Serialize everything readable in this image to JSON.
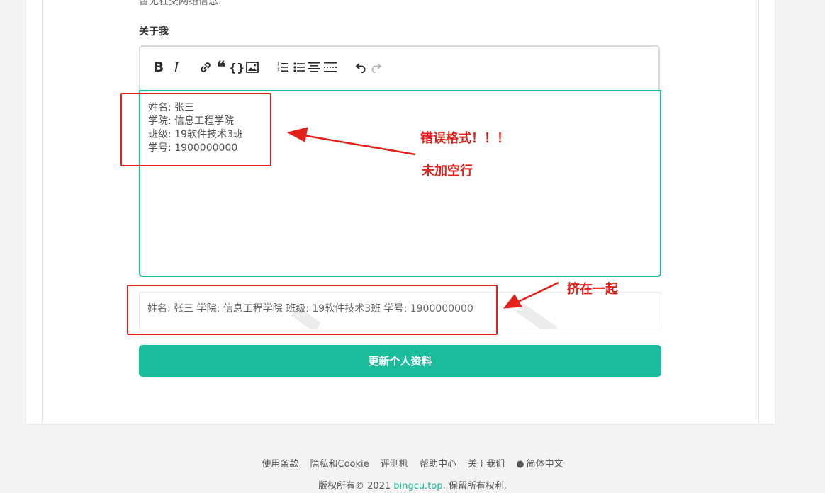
{
  "page": {
    "cut_text": "暂无社交网络信息.",
    "section_label": "关于我"
  },
  "toolbar": {
    "buttons": [
      {
        "name": "bold-icon",
        "glyph": "B"
      },
      {
        "name": "italic-icon",
        "glyph": "I"
      },
      {
        "name": "link-icon"
      },
      {
        "name": "quote-icon",
        "glyph": "66"
      },
      {
        "name": "code-icon",
        "glyph": "{}"
      },
      {
        "name": "image-icon"
      },
      {
        "name": "ordered-list-icon"
      },
      {
        "name": "unordered-list-icon"
      },
      {
        "name": "horizontal-rule-icon"
      },
      {
        "name": "page-break-icon"
      },
      {
        "name": "undo-icon"
      },
      {
        "name": "redo-icon"
      }
    ]
  },
  "editor": {
    "lines": [
      "姓名: 张三",
      "学院: 信息工程学院",
      "班级: 19软件技术3班",
      "学号: 1900000000"
    ]
  },
  "preview": {
    "text": "姓名: 张三 学院: 信息工程学院 班级: 19软件技术3班 学号: 1900000000"
  },
  "submit": {
    "label": "更新个人资料"
  },
  "annotations": {
    "wrong_format": "错误格式！！！",
    "no_blank_line": "未加空行",
    "squeezed": "挤在一起",
    "color": "#e3201b"
  },
  "footer": {
    "links": [
      "使用条款",
      "隐私和Cookie",
      "评测机",
      "帮助中心",
      "关于我们"
    ],
    "language": "简体中文",
    "copyright_prefix": "版权所有© 2021 ",
    "copyright_link": "bingcu.top",
    "copyright_suffix": ". 保留所有权利."
  },
  "colors": {
    "accent": "#1abc9c",
    "annotation": "#e3201b"
  }
}
